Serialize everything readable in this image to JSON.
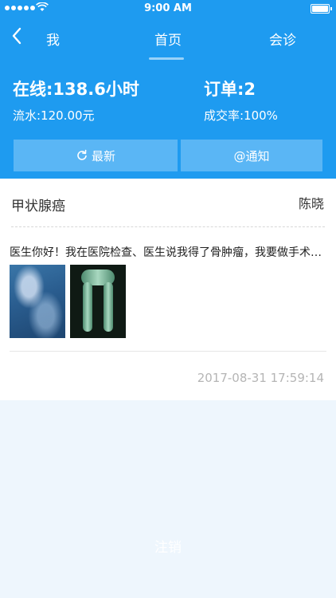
{
  "status_bar": {
    "time": "9:00 AM"
  },
  "nav": {
    "left_label": "我",
    "center_label": "首页",
    "right_label": "会诊"
  },
  "stats": {
    "online": "在线:138.6小时",
    "revenue": "流水:120.00元",
    "orders": "订单:2",
    "conversion": "成交率:100%"
  },
  "buttons": {
    "refresh": "最新",
    "notify": "@通知"
  },
  "case": {
    "diagnosis": "甲状腺癌",
    "doctor": "陈晓",
    "message": "医生你好！我在医院检查、医生说我得了骨肿瘤，我要做手术怎么办",
    "timestamp": "2017-08-31 17:59:14"
  },
  "footer": {
    "logout": "注销"
  },
  "colors": {
    "header": "#1e9bf0",
    "button": "#5ab6f5",
    "background": "#eef6fd"
  }
}
